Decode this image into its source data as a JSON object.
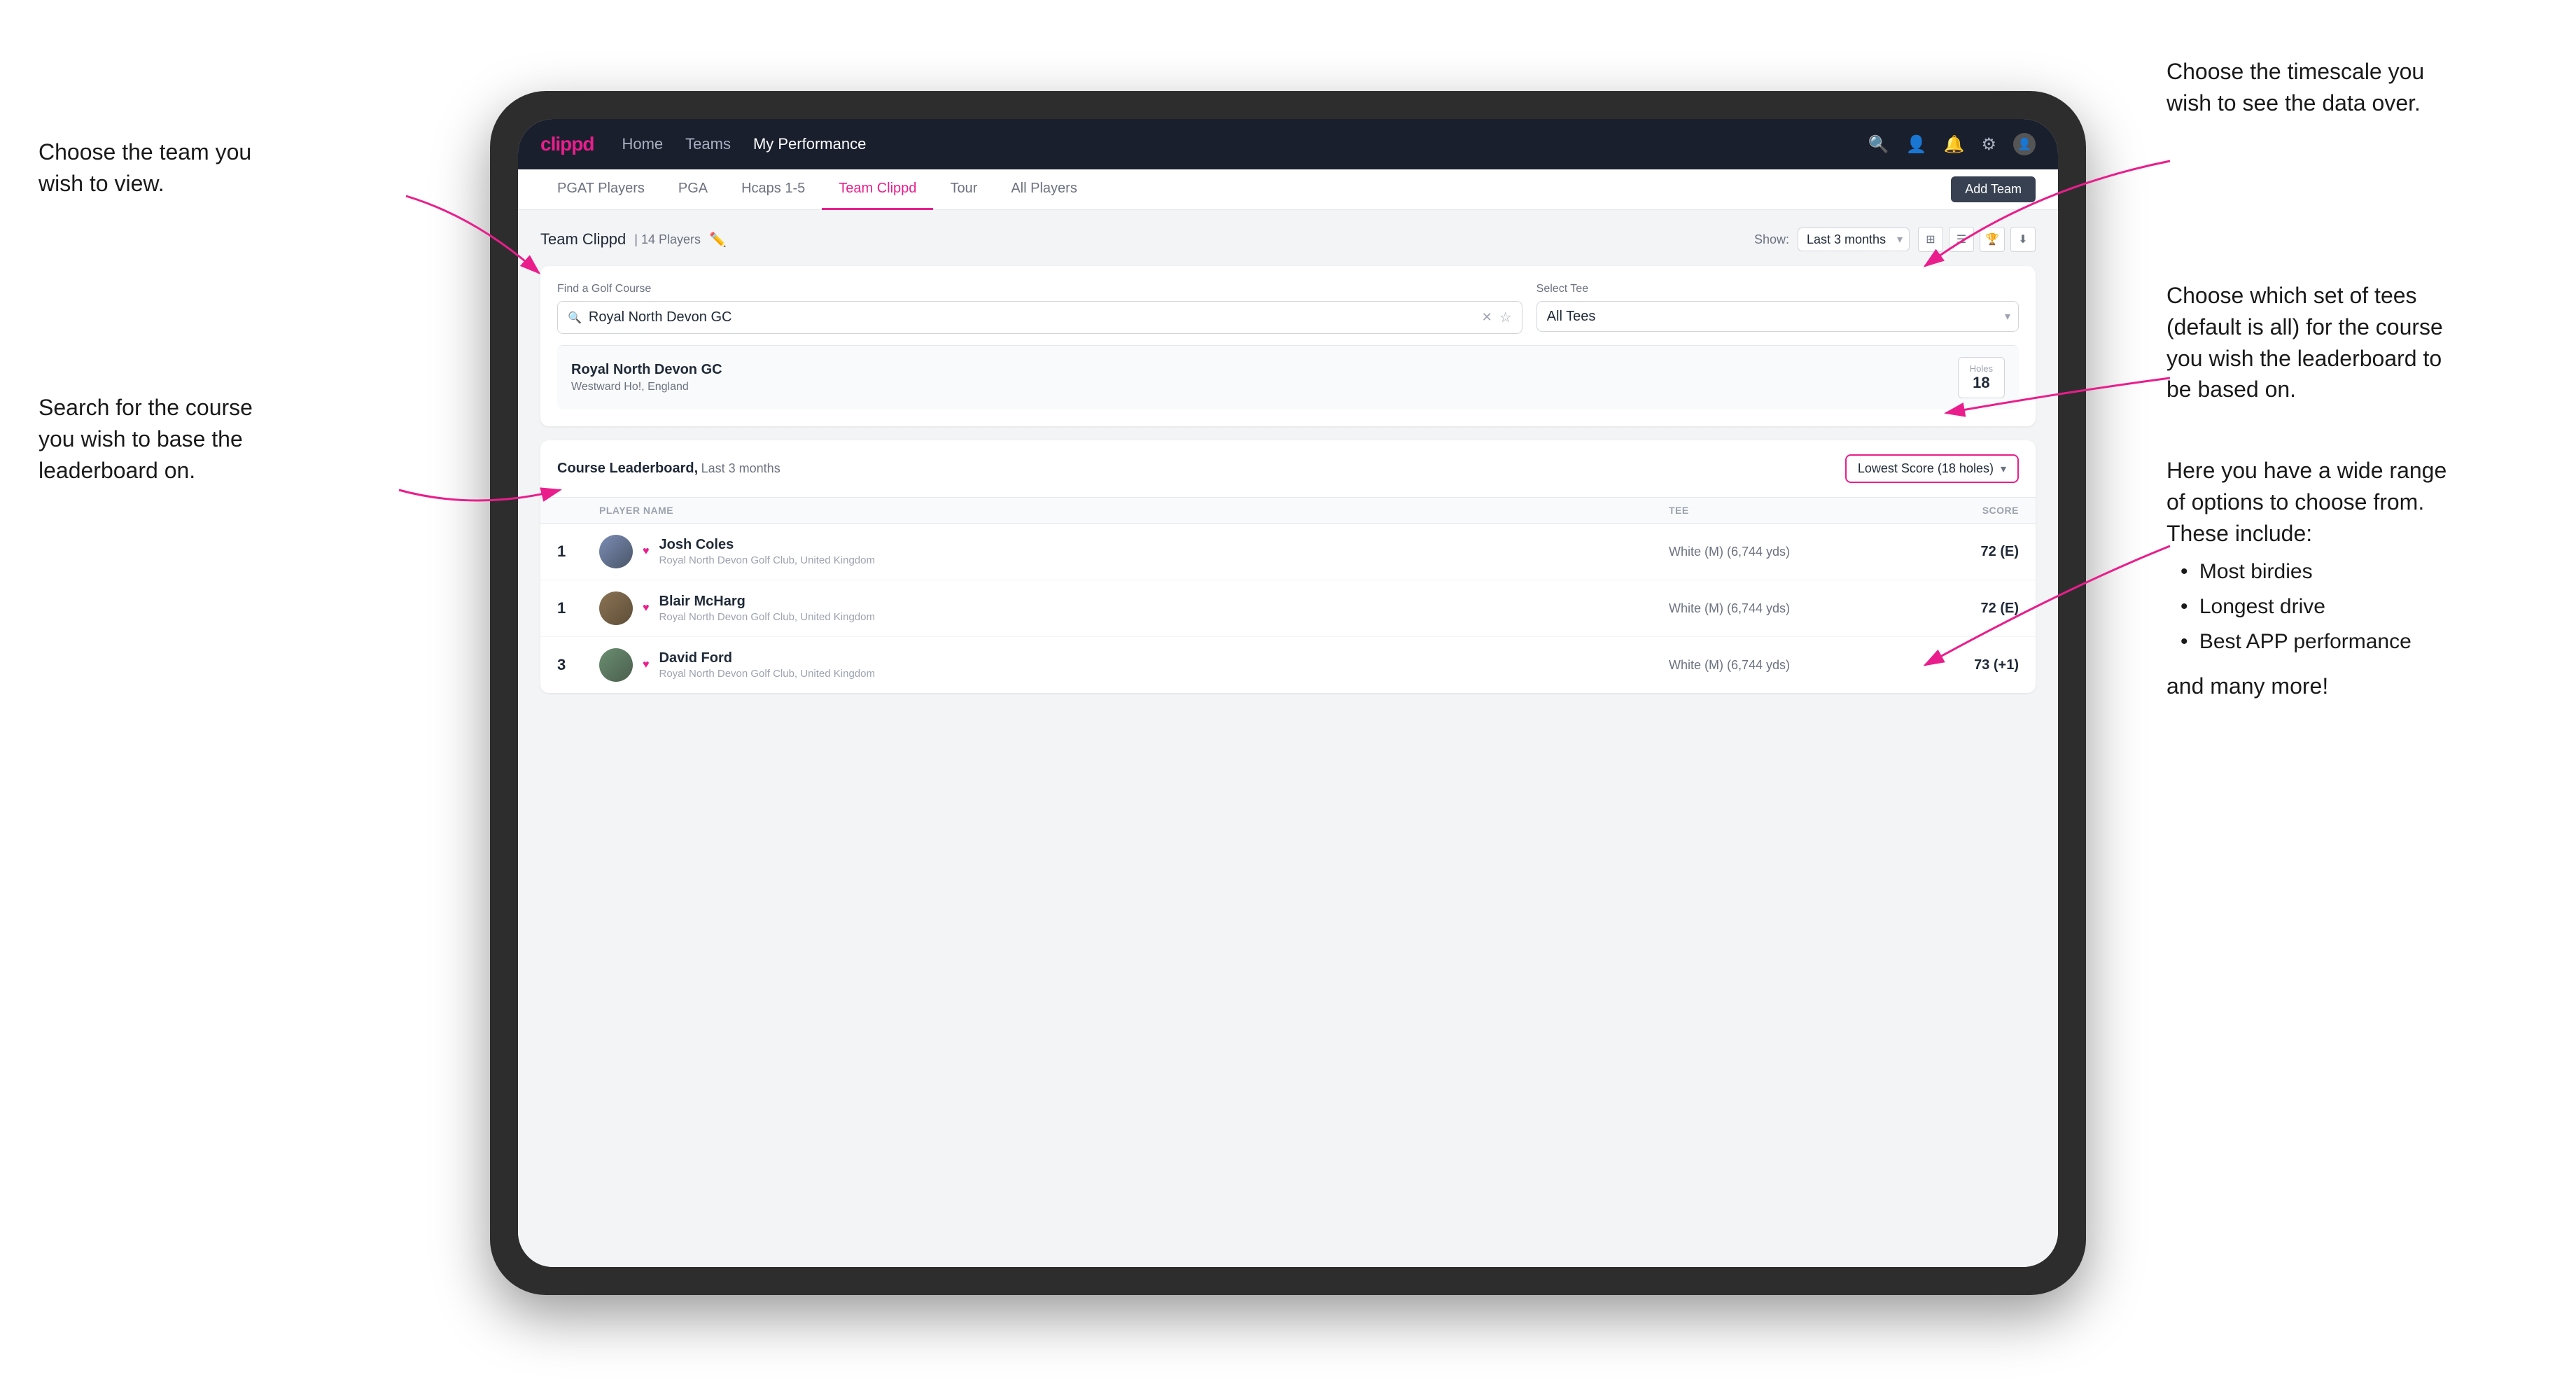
{
  "annotations": {
    "team_title": "Choose the team you\nwish to view.",
    "search_title": "Search for the course\nyou wish to base the\nleaderboard on.",
    "timescale_title": "Choose the timescale you\nwish to see the data over.",
    "tees_title": "Choose which set of tees\n(default is all) for the course\nyou wish the leaderboard to\nbe based on.",
    "options_title": "Here you have a wide range\nof options to choose from.\nThese include:",
    "options_bullets": [
      "Most birdies",
      "Longest drive",
      "Best APP performance"
    ],
    "and_more": "and many more!"
  },
  "nav": {
    "logo": "clippd",
    "links": [
      "Home",
      "Teams",
      "My Performance"
    ],
    "active_link": "My Performance"
  },
  "sub_nav": {
    "tabs": [
      "PGAT Players",
      "PGA",
      "Hcaps 1-5",
      "Team Clippd",
      "Tour",
      "All Players"
    ],
    "active_tab": "Team Clippd",
    "add_team_label": "Add Team"
  },
  "team_header": {
    "title": "Team Clippd",
    "player_count": "14 Players",
    "show_label": "Show:",
    "show_value": "Last 3 months"
  },
  "search": {
    "section_label": "Find a Golf Course",
    "placeholder": "Royal North Devon GC",
    "tee_label": "Select Tee",
    "tee_value": "All Tees"
  },
  "course_result": {
    "name": "Royal North Devon GC",
    "location": "Westward Ho!, England",
    "holes_label": "Holes",
    "holes_value": "18"
  },
  "leaderboard": {
    "title": "Course Leaderboard,",
    "subtitle": "Last 3 months",
    "score_type": "Lowest Score (18 holes)",
    "columns": [
      "PLAYER NAME",
      "TEE",
      "SCORE"
    ],
    "players": [
      {
        "rank": "1",
        "name": "Josh Coles",
        "club": "Royal North Devon Golf Club, United Kingdom",
        "tee": "White (M) (6,744 yds)",
        "score": "72 (E)"
      },
      {
        "rank": "1",
        "name": "Blair McHarg",
        "club": "Royal North Devon Golf Club, United Kingdom",
        "tee": "White (M) (6,744 yds)",
        "score": "72 (E)"
      },
      {
        "rank": "3",
        "name": "David Ford",
        "club": "Royal North Devon Golf Club, United Kingdom",
        "tee": "White (M) (6,744 yds)",
        "score": "73 (+1)"
      }
    ]
  },
  "colors": {
    "brand_pink": "#e91e8c",
    "nav_bg": "#1a1f2e",
    "active_tab_color": "#e91e8c"
  }
}
